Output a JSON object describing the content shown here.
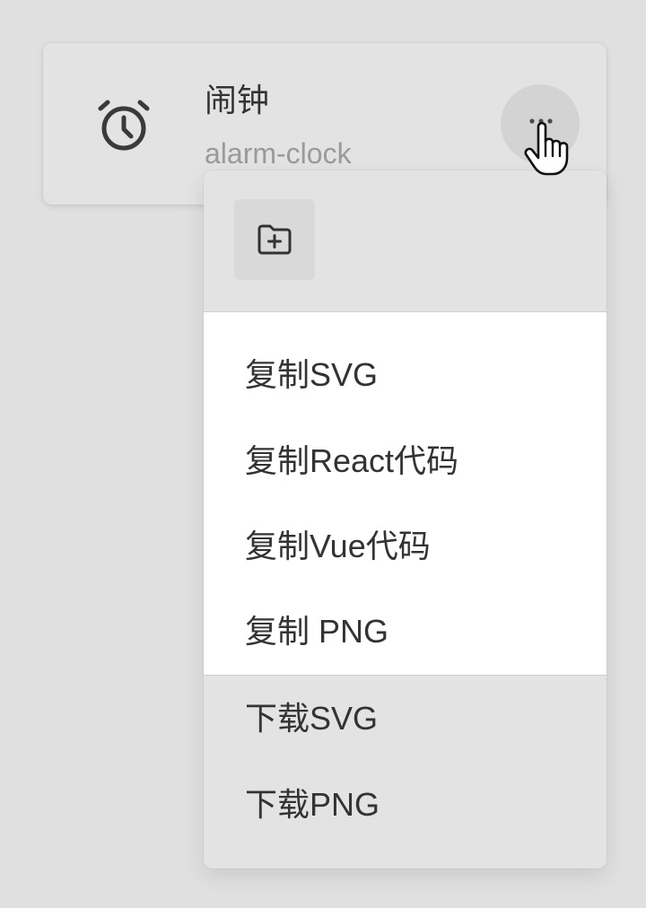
{
  "card": {
    "title": "闹钟",
    "subtitle": "alarm-clock",
    "icon": "alarm-clock-icon",
    "more_icon": "more-horizontal-icon"
  },
  "dropdown": {
    "header_button_icon": "folder-add-icon",
    "copy_items": [
      {
        "label": "复制SVG"
      },
      {
        "label": "复制React代码"
      },
      {
        "label": "复制Vue代码"
      },
      {
        "label": "复制 PNG"
      }
    ],
    "download_items": [
      {
        "label": "下载SVG"
      },
      {
        "label": "下载PNG"
      }
    ]
  },
  "colors": {
    "background": "#e0e0e0",
    "card": "#e3e3e3",
    "menu_highlight": "#ffffff",
    "text_primary": "#333333",
    "text_secondary": "#9a9a9a"
  }
}
